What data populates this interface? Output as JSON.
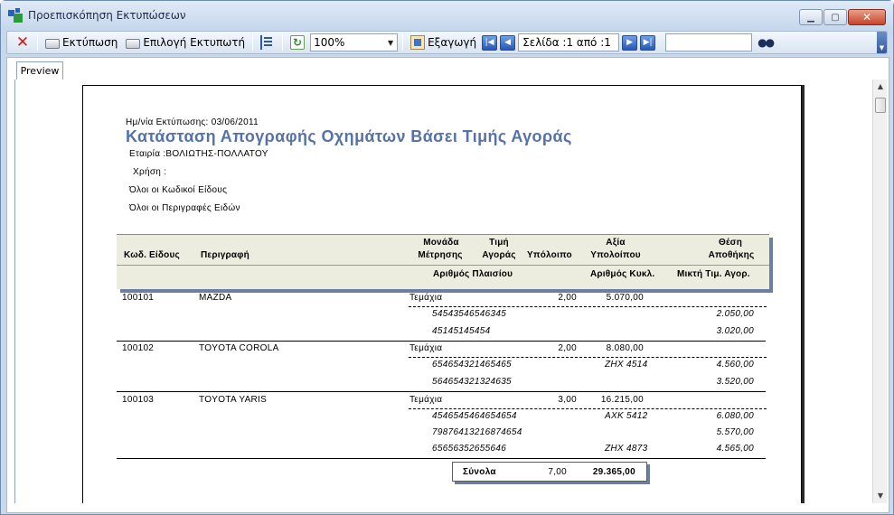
{
  "window": {
    "title": "Προεπισκόπηση Εκτυπώσεων",
    "controls": {
      "minimize": "▁",
      "maximize": "▢",
      "close": "✕"
    }
  },
  "toolbar": {
    "print_label": "Εκτύπωση",
    "select_printer_label": "Επιλογή Εκτυπωτή",
    "zoom_value": "100%",
    "export_label": "Εξαγωγή",
    "page_value": "Σελίδα :1 από :1",
    "search_value": ""
  },
  "tabs": {
    "preview": "Preview"
  },
  "report": {
    "print_date": "Ημ/νία Εκτύπωσης: 03/06/2011",
    "title": "Κατάσταση Απογραφής Οχημάτων Βάσει Τιμής Αγοράς",
    "company": "Εταιρία :ΒΟΛΙΩΤΗΣ-ΠΟΛΛΑΤΟΥ",
    "year": "Χρήση :",
    "filter_codes": "Όλοι οι Κωδικοί Είδους",
    "filter_descriptions": "Όλοι οι Περιγραφές Ειδών",
    "headers": {
      "code": "Κωδ. Είδους",
      "description": "Περιγραφή",
      "unit_1": "Μονάδα",
      "unit_2": "Μέτρησης",
      "price_1": "Τιμή",
      "price_2": "Αγοράς",
      "balance": "Υπόλοιπο",
      "value_1": "Αξία",
      "value_2": "Υπολοίπου",
      "location_1": "Θέση",
      "location_2": "Αποθήκης",
      "chassis": "Αριθμός Πλαισίου",
      "plate": "Αριθμός Κυκλ.",
      "mixed_price": "Μικτή Τιμ. Αγορ."
    },
    "items": [
      {
        "code": "100101",
        "description": "MAZDA",
        "unit": "Τεμάχια",
        "balance": "2,00",
        "value": "5.070,00",
        "details": [
          {
            "chassis": "54543546546345",
            "plate": "",
            "price": "2.050,00"
          },
          {
            "chassis": "45145145454",
            "plate": "",
            "price": "3.020,00"
          }
        ]
      },
      {
        "code": "100102",
        "description": "TOYOTA COROLA",
        "unit": "Τεμάχια",
        "balance": "2,00",
        "value": "8.080,00",
        "details": [
          {
            "chassis": "654654321465465",
            "plate": "ZHX 4514",
            "price": "4.560,00"
          },
          {
            "chassis": "564654321324635",
            "plate": "",
            "price": "3.520,00"
          }
        ]
      },
      {
        "code": "100103",
        "description": "TOYOTA YARIS",
        "unit": "Τεμάχια",
        "balance": "3,00",
        "value": "16.215,00",
        "details": [
          {
            "chassis": "4546545464654654",
            "plate": "AXK 5412",
            "price": "6.080,00"
          },
          {
            "chassis": "79876413216874654",
            "plate": "",
            "price": "5.570,00"
          },
          {
            "chassis": "65656352655646",
            "plate": "ZHX 4873",
            "price": "4.565,00"
          }
        ]
      }
    ],
    "totals": {
      "label": "Σύνολα",
      "balance": "7,00",
      "value": "29.365,00"
    }
  }
}
